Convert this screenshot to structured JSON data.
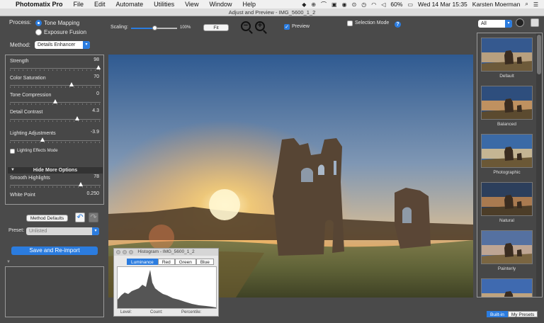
{
  "menubar": {
    "app": "Photomatix Pro",
    "items": [
      "File",
      "Edit",
      "Automate",
      "Utilities",
      "View",
      "Window",
      "Help"
    ],
    "battery": "60%",
    "datetime": "Wed 14 Mar  15:35",
    "user": "Karsten Moerman"
  },
  "window": {
    "title": "Adjust and Preview - IMG_5600_1_2"
  },
  "process": {
    "label": "Process:",
    "options": [
      {
        "label": "Tone Mapping",
        "selected": true
      },
      {
        "label": "Exposure Fusion",
        "selected": false
      }
    ]
  },
  "method": {
    "label": "Method:",
    "value": "Details Enhancer"
  },
  "scaling": {
    "label": "Scaling:",
    "value": "100%",
    "fraction": 0.5,
    "fit_label": "Fit"
  },
  "preview": {
    "label": "Preview",
    "checked": true
  },
  "selection_mode": {
    "label": "Selection Mode",
    "checked": false
  },
  "filter": {
    "value": "All"
  },
  "sliders": [
    {
      "label": "Strength",
      "value": "98",
      "position": 0.98
    },
    {
      "label": "Color Saturation",
      "value": "70",
      "position": 0.68
    },
    {
      "label": "Tone Compression",
      "value": "0",
      "position": 0.5
    },
    {
      "label": "Detail Contrast",
      "value": "4.3",
      "position": 0.74
    },
    {
      "label": "Lighting Adjustments",
      "value": "-3.9",
      "position": 0.36
    }
  ],
  "lighting_effects": {
    "label": "Lighting Effects Mode",
    "checked": false
  },
  "hide_more": {
    "label": "Hide More Options"
  },
  "more_sliders": [
    {
      "label": "Smooth Highlights",
      "value": "78",
      "position": 0.78
    },
    {
      "label": "White Point",
      "value": "0.250",
      "position": null
    }
  ],
  "method_defaults": {
    "label": "Method Defaults"
  },
  "preset": {
    "label": "Preset:",
    "value": "Unlisted"
  },
  "save_button": {
    "label": "Save and Re-import"
  },
  "histogram": {
    "title": "Histogram - IMG_5600_1_2",
    "tabs": [
      {
        "label": "Luminance",
        "active": true
      },
      {
        "label": "Red",
        "active": false
      },
      {
        "label": "Green",
        "active": false
      },
      {
        "label": "Blue",
        "active": false
      }
    ],
    "level_label": "Level:",
    "count_label": "Count:",
    "percentile_label": "Percentile:"
  },
  "presets": [
    {
      "name": "Default"
    },
    {
      "name": "Balanced"
    },
    {
      "name": "Photographic"
    },
    {
      "name": "Natural"
    },
    {
      "name": "Painterly"
    },
    {
      "name": ""
    }
  ],
  "preset_tabs": [
    {
      "label": "Built-in",
      "active": true
    },
    {
      "label": "My Presets",
      "active": false
    }
  ],
  "colors": {
    "accent": "#2b7cdf",
    "panel": "#4a4a4a"
  }
}
